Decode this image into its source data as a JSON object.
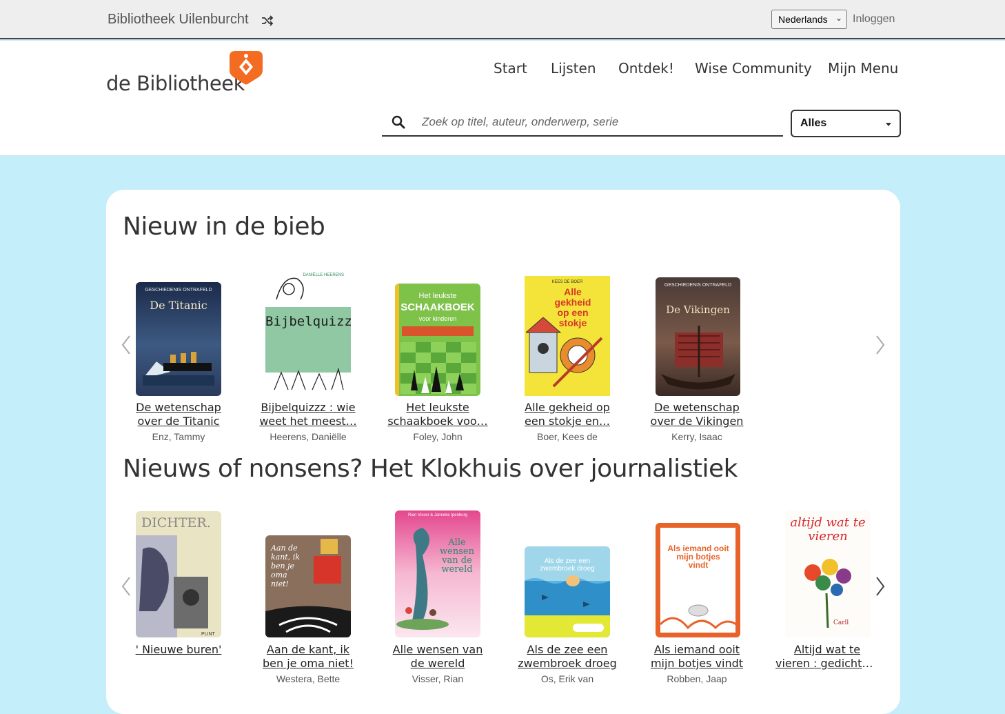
{
  "topbar": {
    "library_name": "Bibliotheek Uilenburcht",
    "language": "Nederlands",
    "login": "Inloggen"
  },
  "header": {
    "logo_text": "de Bibliotheek",
    "nav": [
      "Start",
      "Lijsten",
      "Ontdek!",
      "Wise Community",
      "Mijn Menu"
    ],
    "search_placeholder": "Zoek op titel, auteur, onderwerp, serie",
    "scope": "Alles"
  },
  "colors": {
    "brand_orange": "#f36c21",
    "page_bg": "#c5eefb"
  },
  "sections": [
    {
      "title": "Nieuw in de bieb",
      "books": [
        {
          "title_l1": "De wetenschap",
          "title_l2": "over de Titanic",
          "author": "Enz, Tammy",
          "cover_label": "De Titanic"
        },
        {
          "title_l1": "Bijbelquizzz : wie",
          "title_l2": "weet het meest…",
          "author": "Heerens, Daniëlle",
          "cover_label": "Bijbelquizzz"
        },
        {
          "title_l1": "Het leukste",
          "title_l2": "schaakboek voo…",
          "author": "Foley, John",
          "cover_label": "SCHAAKBOEK"
        },
        {
          "title_l1": "Alle gekheid op",
          "title_l2": "een stokje en…",
          "author": "Boer, Kees de",
          "cover_label": "Alle gekheid op een stokje"
        },
        {
          "title_l1": "De wetenschap",
          "title_l2": "over de Vikingen",
          "author": "Kerry, Isaac",
          "cover_label": "De Vikingen"
        }
      ]
    },
    {
      "title": "Nieuws of nonsens? Het Klokhuis over journalistiek",
      "books": [
        {
          "title_l1": "' Nieuwe buren'",
          "title_l2": "",
          "author": "",
          "cover_label": "DICHTER."
        },
        {
          "title_l1": "Aan de kant, ik",
          "title_l2": "ben je oma niet!",
          "author": "Westera, Bette",
          "cover_label": "Aan de kant, ik ben je oma niet!"
        },
        {
          "title_l1": "Alle wensen van",
          "title_l2": "de wereld",
          "author": "Visser, Rian",
          "cover_label": "Alle wensen van de wereld"
        },
        {
          "title_l1": "Als de zee een",
          "title_l2": "zwembroek droeg",
          "author": "Os, Erik van",
          "cover_label": "Als de zee een zwembroek droeg"
        },
        {
          "title_l1": "Als iemand ooit",
          "title_l2": "mijn botjes vindt",
          "author": "Robben, Jaap",
          "cover_label": "Als iemand ooit mijn botjes vindt"
        },
        {
          "title_l1": "Altijd wat te",
          "title_l2": "vieren : gedichte…",
          "author": "",
          "cover_label": "altijd wat te vieren"
        }
      ]
    }
  ]
}
